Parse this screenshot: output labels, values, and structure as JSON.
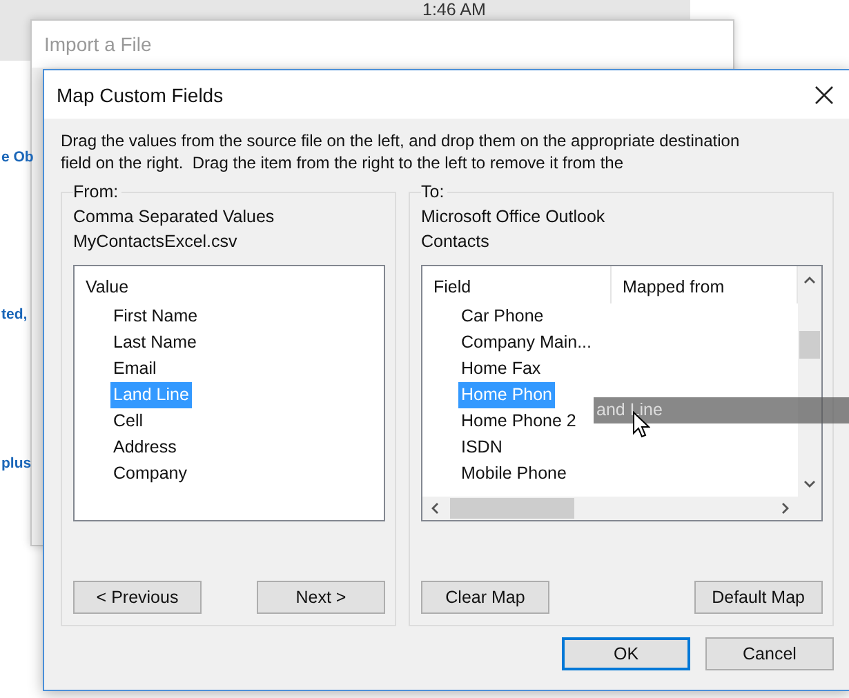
{
  "background": {
    "time": "1:46 AM",
    "link_fragments": [
      "e Ob",
      "ted,",
      "plus"
    ]
  },
  "back_window": {
    "title": "Import a File"
  },
  "dialog": {
    "title": "Map Custom Fields",
    "instructions": "Drag the values from the source file on the left, and drop them on the appropriate destination field on the right.  Drag the item from the right to the left to remove it from the",
    "from": {
      "label": "From:",
      "lines": [
        "Comma Separated Values",
        "MyContactsExcel.csv"
      ],
      "column": "Value",
      "items": [
        {
          "text": "First Name",
          "selected": false
        },
        {
          "text": "Last Name",
          "selected": false
        },
        {
          "text": "Email",
          "selected": false
        },
        {
          "text": "Land Line",
          "selected": true
        },
        {
          "text": "Cell",
          "selected": false
        },
        {
          "text": "Address",
          "selected": false
        },
        {
          "text": "Company",
          "selected": false
        }
      ],
      "buttons": [
        "< Previous",
        "Next >"
      ]
    },
    "to": {
      "label": "To:",
      "lines": [
        "Microsoft Office Outlook",
        "Contacts"
      ],
      "columns": [
        "Field",
        "Mapped from"
      ],
      "items": [
        {
          "text": "Car Phone",
          "selected": false
        },
        {
          "text": "Company Main...",
          "selected": false
        },
        {
          "text": "Home Fax",
          "selected": false
        },
        {
          "text": "Home Phon",
          "selected": true
        },
        {
          "text": "Home Phone 2",
          "selected": false
        },
        {
          "text": "ISDN",
          "selected": false
        },
        {
          "text": "Mobile Phone",
          "selected": false
        }
      ],
      "buttons": [
        "Clear Map",
        "Default Map"
      ]
    },
    "drag_label": "and Line",
    "buttons": [
      {
        "label": "OK",
        "default": true
      },
      {
        "label": "Cancel",
        "default": false
      }
    ]
  }
}
